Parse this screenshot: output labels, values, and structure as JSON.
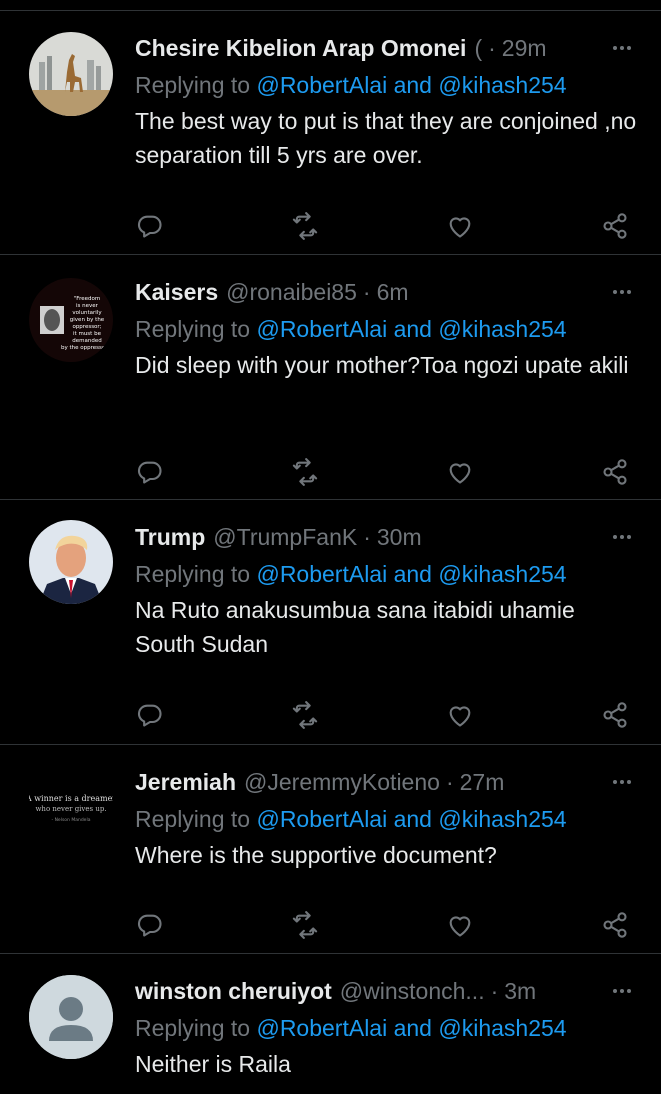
{
  "tweets": [
    {
      "name": "Chesire Kibelion Arap Omonei",
      "name_suffix": "(",
      "handle": "",
      "time": "29m",
      "replying_prefix": "Replying to",
      "replying_to_1": "@RobertAlai",
      "replying_and": "and",
      "replying_to_2": "@kihash254",
      "text": "The best way to put is that they are conjoined ,no separation till 5 yrs are over.",
      "avatar_icon": "giraffe-city-icon"
    },
    {
      "name": "Kaisers",
      "name_suffix": "",
      "handle": "@ronaibei85",
      "time": "6m",
      "replying_prefix": "Replying to",
      "replying_to_1": "@RobertAlai",
      "replying_and": "and",
      "replying_to_2": "@kihash254",
      "text": "Did sleep with your mother?Toa ngozi upate akili",
      "avatar_icon": "quote-portrait-icon",
      "avatar_quote": "\"Freedom is never voluntarily given by the oppressor; it must be demanded by the oppressed.\""
    },
    {
      "name": "Trump",
      "name_suffix": "",
      "handle": "@TrumpFanK",
      "time": "30m",
      "replying_prefix": "Replying to",
      "replying_to_1": "@RobertAlai",
      "replying_and": "and",
      "replying_to_2": "@kihash254",
      "text": "Na Ruto anakusumbua sana itabidi uhamie South Sudan",
      "avatar_icon": "portrait-icon"
    },
    {
      "name": "Jeremiah",
      "name_suffix": "",
      "handle": "@JeremmyKotieno",
      "time": "27m",
      "replying_prefix": "Replying to",
      "replying_to_1": "@RobertAlai",
      "replying_and": "and",
      "replying_to_2": "@kihash254",
      "text": "Where is the supportive document?",
      "avatar_icon": "quote-text-icon",
      "avatar_quote_1": "A winner is a dreamer",
      "avatar_quote_2": "who never gives up.",
      "avatar_quote_3": "- Nelson Mandela"
    },
    {
      "name": "winston cheruiyot",
      "name_suffix": "",
      "handle": "@winstonch...",
      "time": "3m",
      "replying_prefix": "Replying to",
      "replying_to_1": "@RobertAlai",
      "replying_and": "and",
      "replying_to_2": "@kihash254",
      "text": "Neither is Raila",
      "avatar_icon": "default-profile-icon"
    }
  ],
  "colors": {
    "background": "#000000",
    "text": "#e7e9ea",
    "muted": "#71767b",
    "link": "#1d9bf0",
    "divider": "#2f3336"
  }
}
